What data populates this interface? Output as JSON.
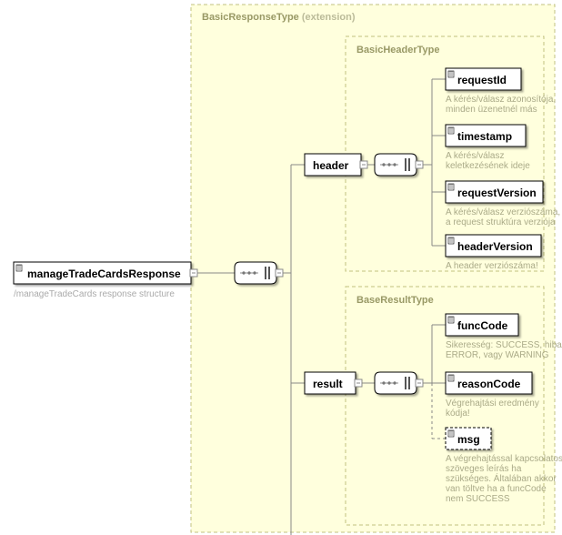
{
  "root": {
    "name": "manageTradeCardsResponse",
    "desc": "/manageTradeCards response structure"
  },
  "extension": {
    "type": "BasicResponseType",
    "suffix": "(extension)"
  },
  "header": {
    "type": "BasicHeaderType",
    "node": "header",
    "items": [
      {
        "name": "requestId",
        "desc": [
          "A kérés/válasz azonosítója,",
          "minden üzenetnél más"
        ],
        "optional": false
      },
      {
        "name": "timestamp",
        "desc": [
          "A kérés/válasz",
          "keletkezésének ideje"
        ],
        "optional": false
      },
      {
        "name": "requestVersion",
        "desc": [
          "A kérés/válasz verziószáma,",
          "a request struktúra verziója"
        ],
        "optional": false
      },
      {
        "name": "headerVersion",
        "desc": [
          "A header verziószáma!"
        ],
        "optional": false
      }
    ]
  },
  "result": {
    "type": "BaseResultType",
    "node": "result",
    "items": [
      {
        "name": "funcCode",
        "desc": [
          "Sikeresség: SUCCESS, hiba",
          "ERROR, vagy WARNING"
        ],
        "optional": false
      },
      {
        "name": "reasonCode",
        "desc": [
          "Végrehajtási eredmény",
          "kódja!"
        ],
        "optional": false
      },
      {
        "name": "msg",
        "desc": [
          "A végrehajtással kapcsolatos",
          "szöveges leírás ha",
          "szükséges. Általában akkor",
          "van töltve ha a funcCode",
          "nem SUCCESS"
        ],
        "optional": true
      }
    ]
  },
  "chart_data": {
    "type": "tree",
    "note": "XML schema hierarchy diagram",
    "root": "manageTradeCardsResponse",
    "extension_base": "BasicResponseType",
    "children": [
      {
        "name": "header",
        "type": "BasicHeaderType",
        "sequence": [
          "requestId",
          "timestamp",
          "requestVersion",
          "headerVersion"
        ]
      },
      {
        "name": "result",
        "type": "BaseResultType",
        "sequence": [
          "funcCode",
          "reasonCode",
          "msg?"
        ]
      }
    ]
  }
}
